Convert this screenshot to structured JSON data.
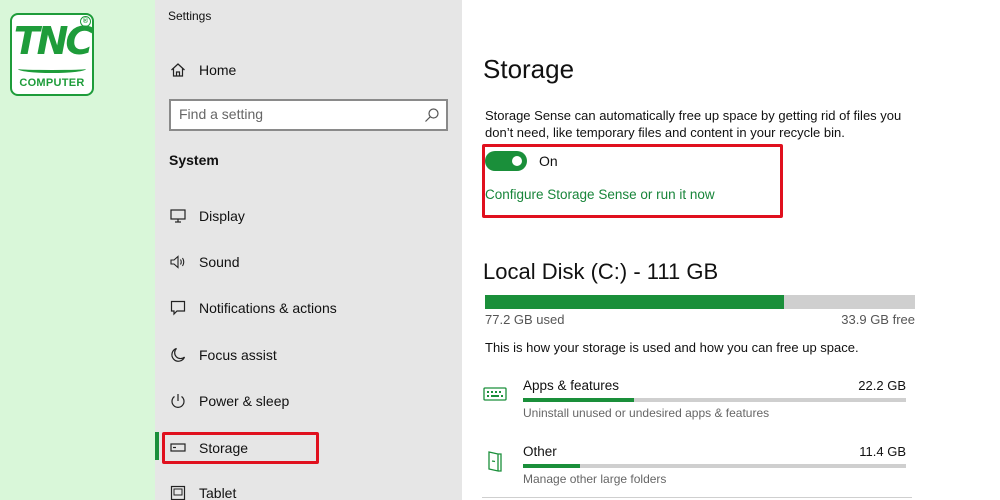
{
  "brand": {
    "name": "TNC",
    "tagline": "COMPUTER",
    "accent": "#1e9c3a"
  },
  "app": {
    "title": "Settings"
  },
  "nav": {
    "home_label": "Home",
    "search_placeholder": "Find a setting",
    "section_label": "System",
    "items": [
      {
        "label": "Display",
        "icon": "monitor-icon"
      },
      {
        "label": "Sound",
        "icon": "speaker-icon"
      },
      {
        "label": "Notifications & actions",
        "icon": "message-icon"
      },
      {
        "label": "Focus assist",
        "icon": "moon-icon"
      },
      {
        "label": "Power & sleep",
        "icon": "power-icon"
      },
      {
        "label": "Storage",
        "icon": "drive-icon",
        "active": true
      },
      {
        "label": "Tablet",
        "icon": "tablet-icon"
      }
    ]
  },
  "main": {
    "title": "Storage",
    "sense_description": "Storage Sense can automatically free up space by getting rid of files you don’t need, like temporary files and content in your recycle bin.",
    "toggle_state": "On",
    "toggle_on": true,
    "configure_link": "Configure Storage Sense or run it now",
    "disk": {
      "title": "Local Disk (C:) - 111 GB",
      "used_label": "77.2 GB used",
      "free_label": "33.9 GB free",
      "used_fraction": 0.695
    },
    "usage_text": "This is how your storage is used and how you can free up space.",
    "categories": [
      {
        "name": "Apps & features",
        "size": "22.2 GB",
        "description": "Uninstall unused or undesired apps & features",
        "fraction": 0.29,
        "icon": "apps-features-icon"
      },
      {
        "name": "Other",
        "size": "11.4 GB",
        "description": "Manage other large folders",
        "fraction": 0.15,
        "icon": "other-folder-icon"
      }
    ]
  },
  "colors": {
    "accent_green": "#1a8f3a",
    "highlight_red": "#e0101e",
    "nav_bg": "#e6e6e6",
    "page_bg": "#d9f7d9"
  }
}
